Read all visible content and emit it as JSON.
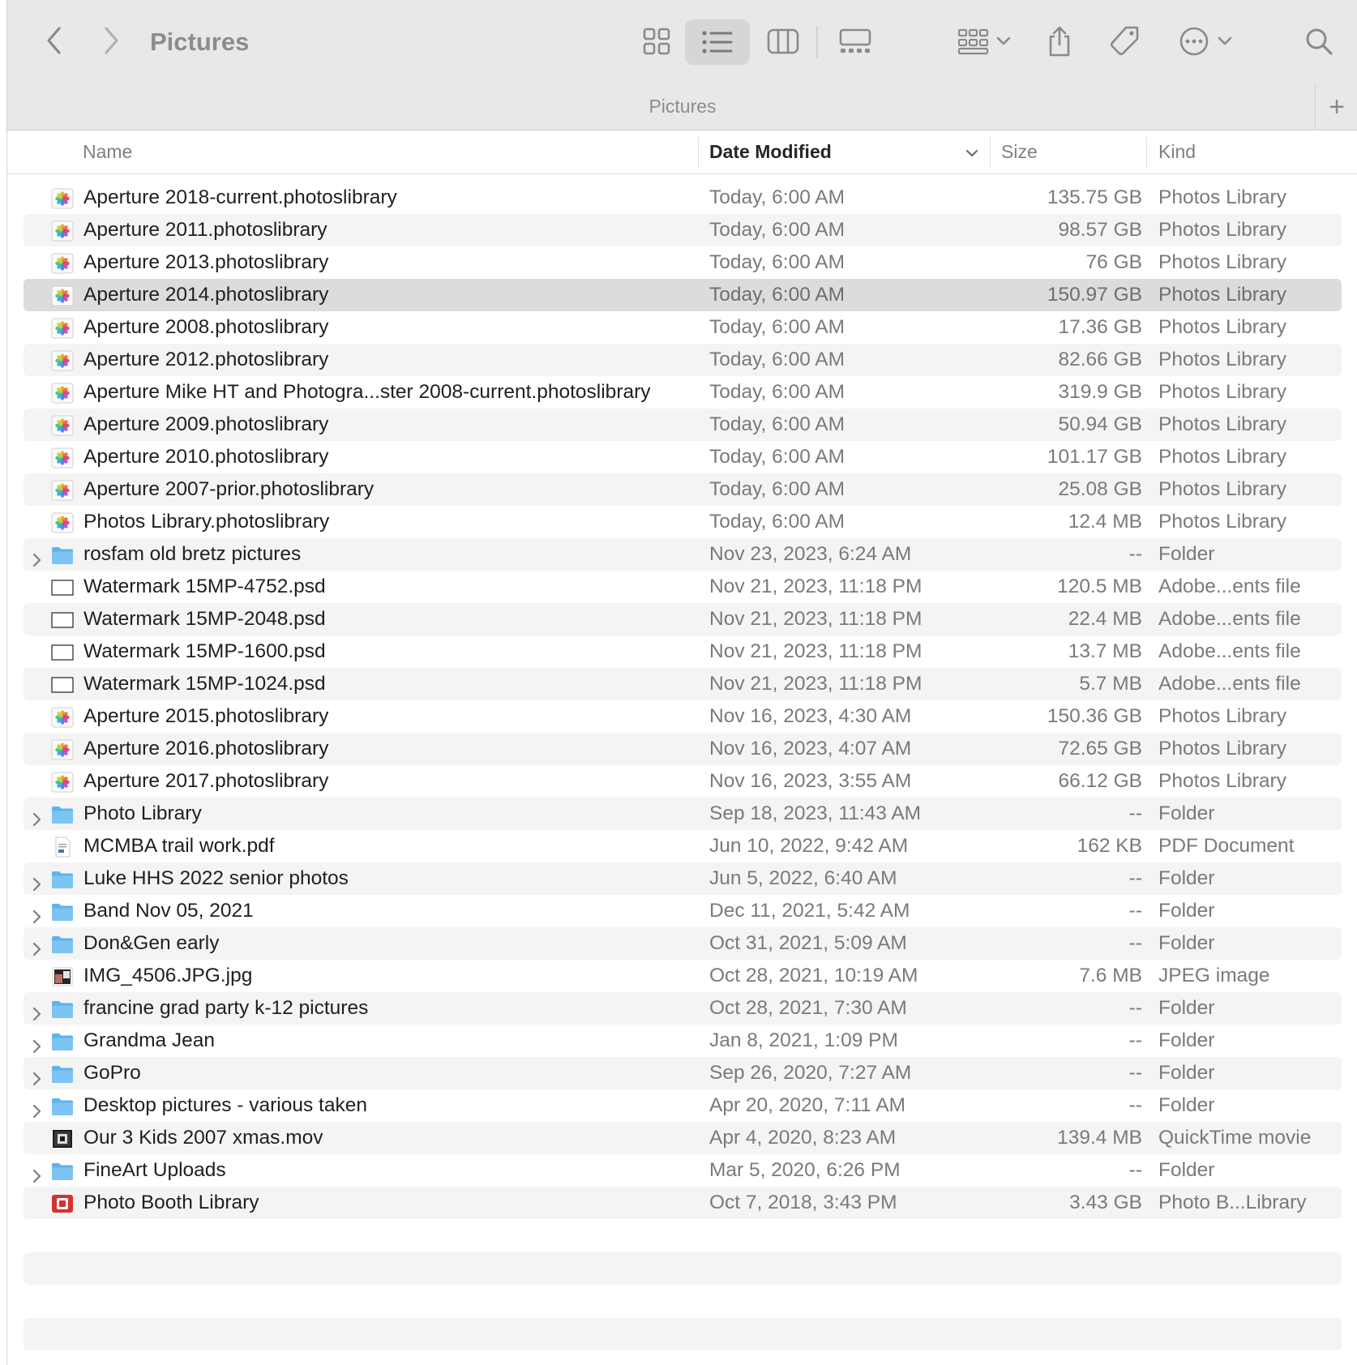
{
  "window": {
    "title": "Pictures",
    "tab_title": "Pictures",
    "tab_add_label": "+"
  },
  "toolbar": {
    "back_icon": "chevron-left-icon",
    "forward_icon": "chevron-right-icon",
    "active_view": "list"
  },
  "columns": {
    "name": "Name",
    "date": "Date Modified",
    "size": "Size",
    "kind": "Kind"
  },
  "files": [
    {
      "name": "Aperture 2018-current.photoslibrary",
      "date": "Today, 6:00 AM",
      "size": "135.75 GB",
      "kind": "Photos Library",
      "icon": "photos-library-icon",
      "folder": false
    },
    {
      "name": "Aperture 2011.photoslibrary",
      "date": "Today, 6:00 AM",
      "size": "98.57 GB",
      "kind": "Photos Library",
      "icon": "photos-library-icon",
      "folder": false
    },
    {
      "name": "Aperture 2013.photoslibrary",
      "date": "Today, 6:00 AM",
      "size": "76 GB",
      "kind": "Photos Library",
      "icon": "photos-library-icon",
      "folder": false
    },
    {
      "name": "Aperture 2014.photoslibrary",
      "date": "Today, 6:00 AM",
      "size": "150.97 GB",
      "kind": "Photos Library",
      "icon": "photos-library-icon",
      "folder": false,
      "selected": true
    },
    {
      "name": "Aperture 2008.photoslibrary",
      "date": "Today, 6:00 AM",
      "size": "17.36 GB",
      "kind": "Photos Library",
      "icon": "photos-library-icon",
      "folder": false
    },
    {
      "name": "Aperture 2012.photoslibrary",
      "date": "Today, 6:00 AM",
      "size": "82.66 GB",
      "kind": "Photos Library",
      "icon": "photos-library-icon",
      "folder": false
    },
    {
      "name": "Aperture Mike HT and Photogra...ster 2008-current.photoslibrary",
      "date": "Today, 6:00 AM",
      "size": "319.9 GB",
      "kind": "Photos Library",
      "icon": "photos-library-icon",
      "folder": false
    },
    {
      "name": "Aperture 2009.photoslibrary",
      "date": "Today, 6:00 AM",
      "size": "50.94 GB",
      "kind": "Photos Library",
      "icon": "photos-library-icon",
      "folder": false
    },
    {
      "name": "Aperture 2010.photoslibrary",
      "date": "Today, 6:00 AM",
      "size": "101.17 GB",
      "kind": "Photos Library",
      "icon": "photos-library-icon",
      "folder": false
    },
    {
      "name": "Aperture 2007-prior.photoslibrary",
      "date": "Today, 6:00 AM",
      "size": "25.08 GB",
      "kind": "Photos Library",
      "icon": "photos-library-icon",
      "folder": false
    },
    {
      "name": "Photos Library.photoslibrary",
      "date": "Today, 6:00 AM",
      "size": "12.4 MB",
      "kind": "Photos Library",
      "icon": "photos-library-icon",
      "folder": false
    },
    {
      "name": "rosfam old bretz pictures",
      "date": "Nov 23, 2023, 6:24 AM",
      "size": "--",
      "kind": "Folder",
      "icon": "folder-icon",
      "folder": true
    },
    {
      "name": "Watermark 15MP-4752.psd",
      "date": "Nov 21, 2023, 11:18 PM",
      "size": "120.5 MB",
      "kind": "Adobe...ents file",
      "icon": "psd-file-icon",
      "folder": false
    },
    {
      "name": "Watermark 15MP-2048.psd",
      "date": "Nov 21, 2023, 11:18 PM",
      "size": "22.4 MB",
      "kind": "Adobe...ents file",
      "icon": "psd-file-icon",
      "folder": false
    },
    {
      "name": "Watermark 15MP-1600.psd",
      "date": "Nov 21, 2023, 11:18 PM",
      "size": "13.7 MB",
      "kind": "Adobe...ents file",
      "icon": "psd-file-icon",
      "folder": false
    },
    {
      "name": "Watermark 15MP-1024.psd",
      "date": "Nov 21, 2023, 11:18 PM",
      "size": "5.7 MB",
      "kind": "Adobe...ents file",
      "icon": "psd-file-icon",
      "folder": false
    },
    {
      "name": "Aperture 2015.photoslibrary",
      "date": "Nov 16, 2023, 4:30 AM",
      "size": "150.36 GB",
      "kind": "Photos Library",
      "icon": "photos-library-icon",
      "folder": false
    },
    {
      "name": "Aperture 2016.photoslibrary",
      "date": "Nov 16, 2023, 4:07 AM",
      "size": "72.65 GB",
      "kind": "Photos Library",
      "icon": "photos-library-icon",
      "folder": false
    },
    {
      "name": "Aperture 2017.photoslibrary",
      "date": "Nov 16, 2023, 3:55 AM",
      "size": "66.12 GB",
      "kind": "Photos Library",
      "icon": "photos-library-icon",
      "folder": false
    },
    {
      "name": "Photo Library",
      "date": "Sep 18, 2023, 11:43 AM",
      "size": "--",
      "kind": "Folder",
      "icon": "folder-icon",
      "folder": true
    },
    {
      "name": "MCMBA trail work.pdf",
      "date": "Jun 10, 2022, 9:42 AM",
      "size": "162 KB",
      "kind": "PDF Document",
      "icon": "pdf-document-icon",
      "folder": false
    },
    {
      "name": "Luke HHS 2022 senior photos",
      "date": "Jun 5, 2022, 6:40 AM",
      "size": "--",
      "kind": "Folder",
      "icon": "folder-icon",
      "folder": true
    },
    {
      "name": "Band Nov 05, 2021",
      "date": "Dec 11, 2021, 5:42 AM",
      "size": "--",
      "kind": "Folder",
      "icon": "folder-icon",
      "folder": true
    },
    {
      "name": "Don&Gen early",
      "date": "Oct 31, 2021, 5:09 AM",
      "size": "--",
      "kind": "Folder",
      "icon": "folder-icon",
      "folder": true
    },
    {
      "name": "IMG_4506.JPG.jpg",
      "date": "Oct 28, 2021, 10:19 AM",
      "size": "7.6 MB",
      "kind": "JPEG image",
      "icon": "jpeg-image-icon",
      "folder": false
    },
    {
      "name": "francine grad party k-12 pictures",
      "date": "Oct 28, 2021, 7:30 AM",
      "size": "--",
      "kind": "Folder",
      "icon": "folder-icon",
      "folder": true
    },
    {
      "name": "Grandma Jean",
      "date": "Jan 8, 2021, 1:09 PM",
      "size": "--",
      "kind": "Folder",
      "icon": "folder-icon",
      "folder": true
    },
    {
      "name": "GoPro",
      "date": "Sep 26, 2020, 7:27 AM",
      "size": "--",
      "kind": "Folder",
      "icon": "folder-icon",
      "folder": true
    },
    {
      "name": "Desktop pictures - various taken",
      "date": "Apr 20, 2020, 7:11 AM",
      "size": "--",
      "kind": "Folder",
      "icon": "folder-icon",
      "folder": true
    },
    {
      "name": "Our 3 Kids 2007 xmas.mov",
      "date": "Apr 4, 2020, 8:23 AM",
      "size": "139.4 MB",
      "kind": "QuickTime movie",
      "icon": "quicktime-movie-icon",
      "folder": false
    },
    {
      "name": "FineArt Uploads",
      "date": "Mar 5, 2020, 6:26 PM",
      "size": "--",
      "kind": "Folder",
      "icon": "folder-icon",
      "folder": true
    },
    {
      "name": "Photo Booth Library",
      "date": "Oct 7, 2018, 3:43 PM",
      "size": "3.43 GB",
      "kind": "Photo B...Library",
      "icon": "photo-booth-library-icon",
      "folder": false
    }
  ]
}
